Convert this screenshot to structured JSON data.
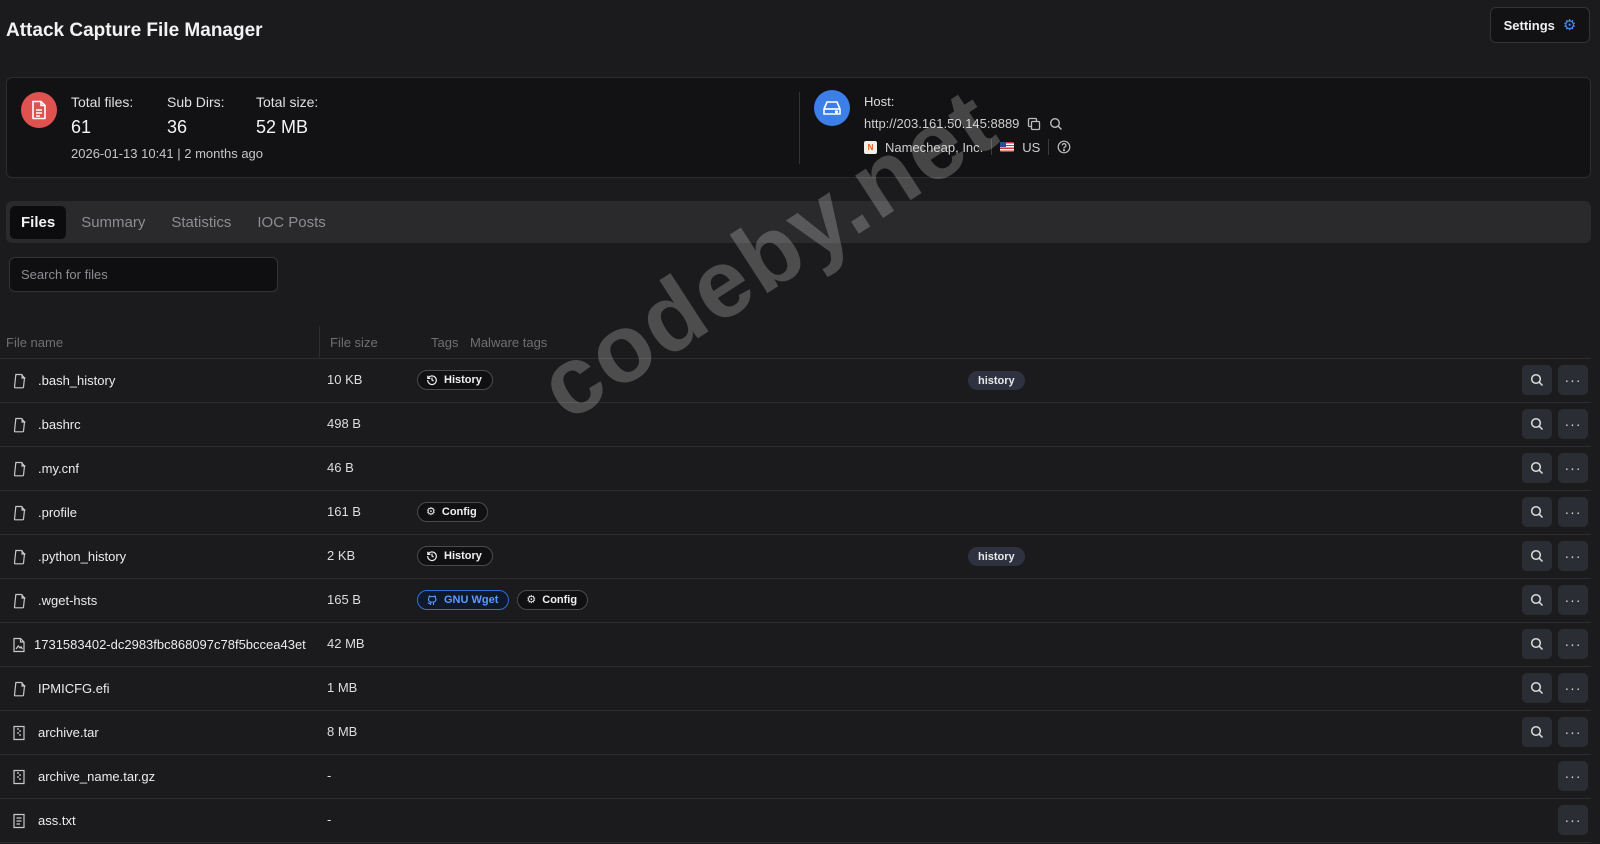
{
  "app_title": "Attack Capture File Manager",
  "settings_label": "Settings",
  "stats": {
    "total_files_label": "Total files:",
    "total_files": "61",
    "sub_dirs_label": "Sub Dirs:",
    "sub_dirs": "36",
    "total_size_label": "Total size:",
    "total_size": "52 MB",
    "timestamp": "2026-01-13 10:41 | 2 months ago"
  },
  "host": {
    "label": "Host:",
    "url": "http://203.161.50.145:8889",
    "provider": "Namecheap, Inc.",
    "country": "US"
  },
  "tabs": [
    {
      "label": "Files",
      "active": true
    },
    {
      "label": "Summary"
    },
    {
      "label": "Statistics"
    },
    {
      "label": "IOC Posts"
    }
  ],
  "search": {
    "placeholder": "Search for files"
  },
  "columns": {
    "name": "File name",
    "size": "File size",
    "tags": "Tags",
    "malware_tags": "Malware tags"
  },
  "rows": [
    {
      "name": ".bash_history",
      "size": "10 KB",
      "icon": "file-icon",
      "tags": [
        {
          "label": "History",
          "icon": "history-icon"
        }
      ],
      "malware_tag": "history",
      "searchable": true
    },
    {
      "name": ".bashrc",
      "size": "498 B",
      "icon": "file-icon",
      "tags": [],
      "malware_tag": "",
      "searchable": true
    },
    {
      "name": ".my.cnf",
      "size": "46 B",
      "icon": "file-icon",
      "tags": [],
      "malware_tag": "",
      "searchable": true
    },
    {
      "name": ".profile",
      "size": "161 B",
      "icon": "file-icon",
      "tags": [
        {
          "label": "Config",
          "icon": "gear-icon"
        }
      ],
      "malware_tag": "",
      "searchable": true
    },
    {
      "name": ".python_history",
      "size": "2 KB",
      "icon": "file-icon",
      "tags": [
        {
          "label": "History",
          "icon": "history-icon"
        }
      ],
      "malware_tag": "history",
      "searchable": true
    },
    {
      "name": ".wget-hsts",
      "size": "165 B",
      "icon": "file-icon",
      "tags": [
        {
          "label": "GNU Wget",
          "icon": "github-icon",
          "accent": "blue"
        },
        {
          "label": "Config",
          "icon": "gear-icon"
        }
      ],
      "malware_tag": "",
      "searchable": true
    },
    {
      "name": "1731583402-dc2983fbc868097c78f5bccea43et",
      "size": "42 MB",
      "icon": "image-file-icon",
      "tags": [],
      "malware_tag": "",
      "searchable": true,
      "long": true
    },
    {
      "name": "IPMICFG.efi",
      "size": "1 MB",
      "icon": "file-icon",
      "tags": [],
      "malware_tag": "",
      "searchable": true
    },
    {
      "name": "archive.tar",
      "size": "8 MB",
      "icon": "archive-icon",
      "tags": [],
      "malware_tag": "",
      "searchable": true
    },
    {
      "name": "archive_name.tar.gz",
      "size": "-",
      "icon": "archive-icon",
      "tags": [],
      "malware_tag": "",
      "searchable": false
    },
    {
      "name": "ass.txt",
      "size": "-",
      "icon": "text-file-icon",
      "tags": [],
      "malware_tag": "",
      "searchable": false
    }
  ],
  "watermark": "codeby.net",
  "colors": {
    "background": "#1b1b1d",
    "card": "#121214",
    "accent_blue": "#3d7fe8",
    "files_badge": "#e0524f",
    "tag_blue": "#5b9bff"
  }
}
